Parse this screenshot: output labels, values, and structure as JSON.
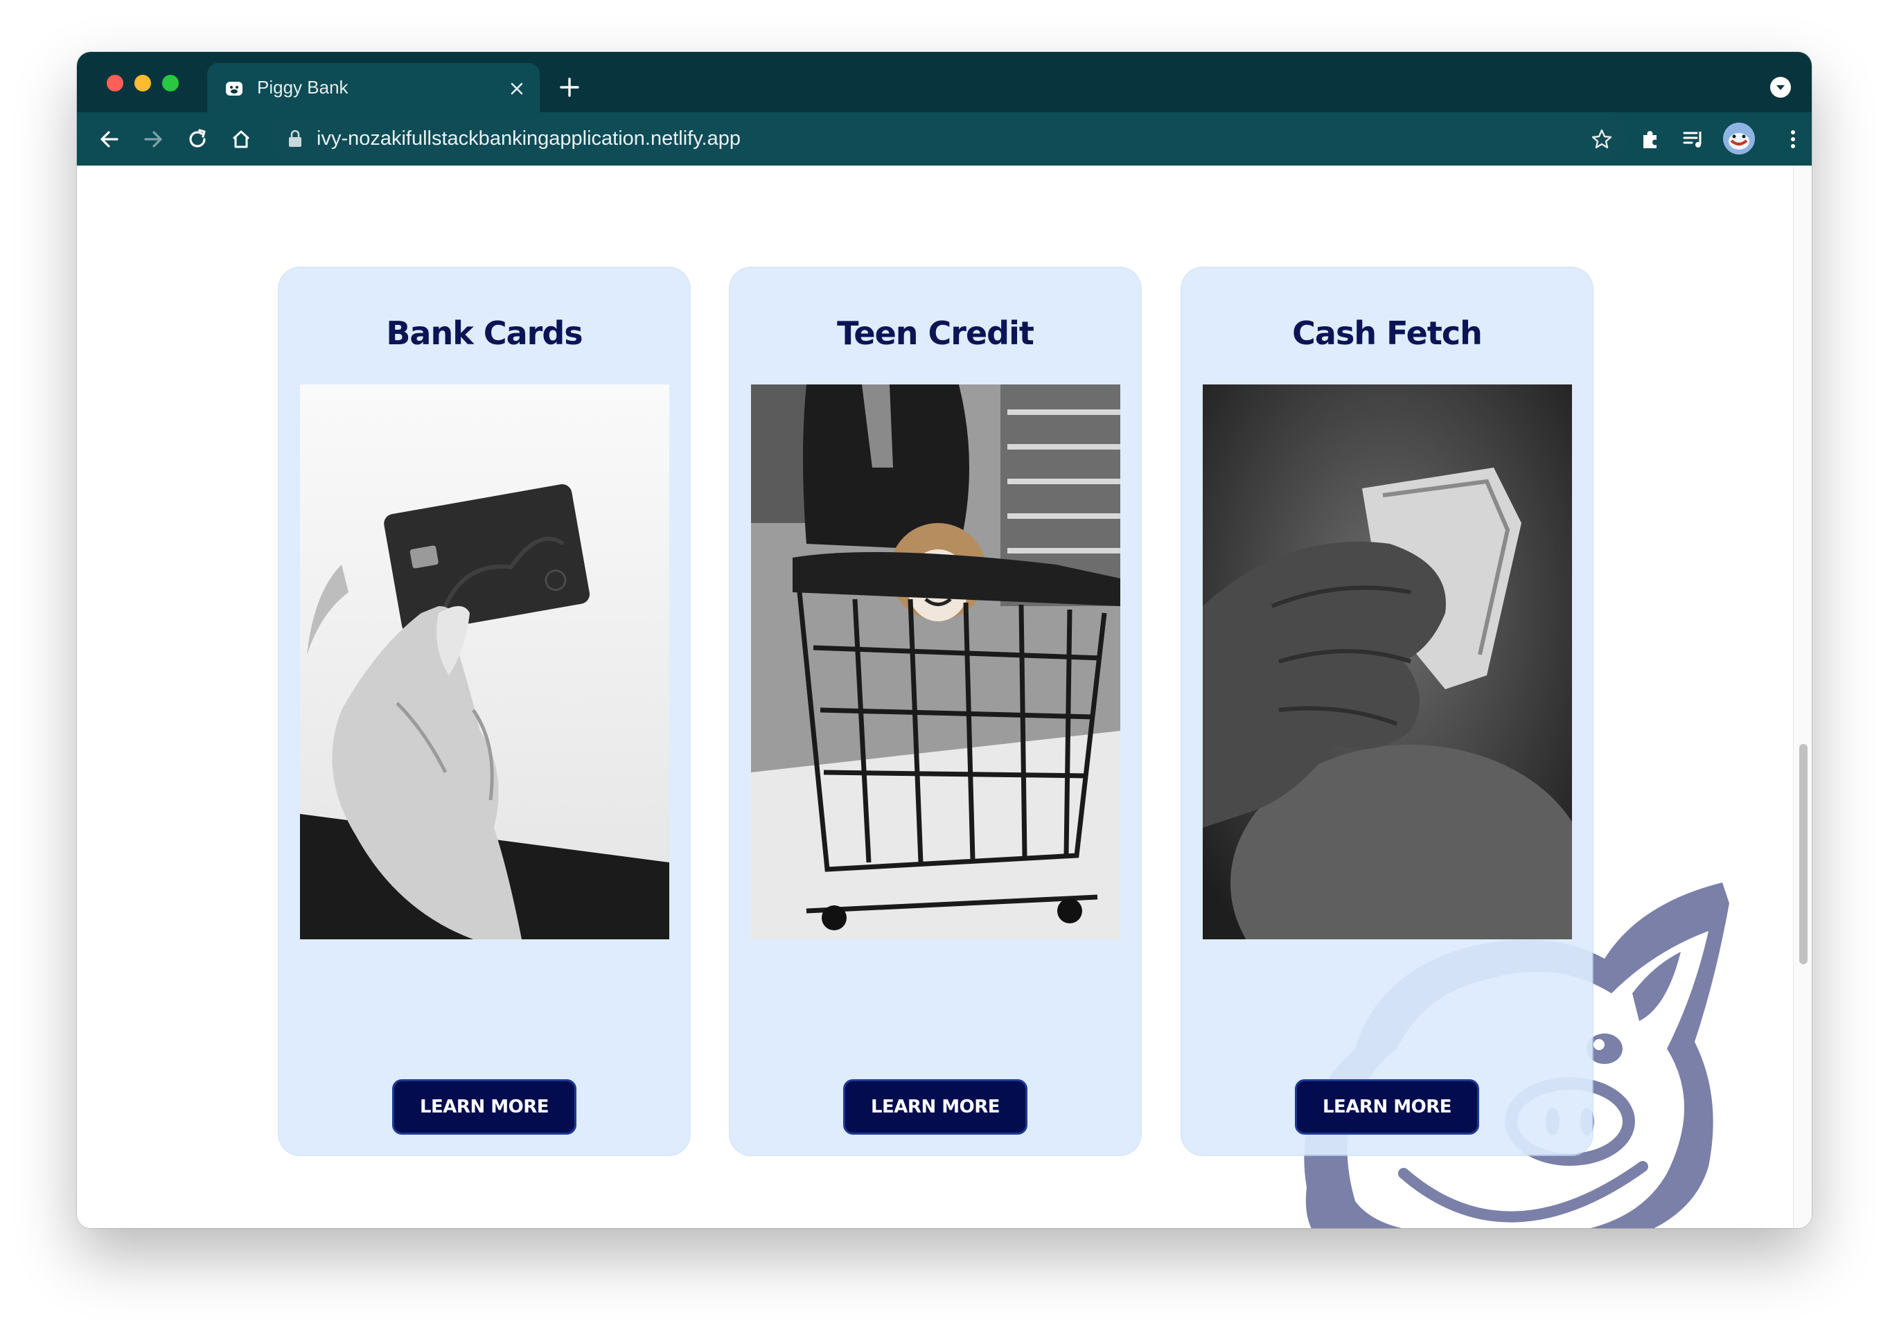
{
  "browser": {
    "tab_title": "Piggy Bank",
    "url": "ivy-nozakifullstackbankingapplication.netlify.app"
  },
  "cards": [
    {
      "title": "Bank Cards",
      "button_label": "LEARN MORE",
      "image_icon": "credit-card-hand-photo"
    },
    {
      "title": "Teen Credit",
      "button_label": "LEARN MORE",
      "image_icon": "shopping-cart-photo"
    },
    {
      "title": "Cash Fetch",
      "button_label": "LEARN MORE",
      "image_icon": "cash-hand-photo"
    }
  ],
  "colors": {
    "browser_frame": "#08353d",
    "toolbar": "#0d4b55",
    "card_background": "#dbeafe",
    "heading": "#0b1454",
    "button": "#030c4f",
    "mascot": "#7a80a8"
  }
}
